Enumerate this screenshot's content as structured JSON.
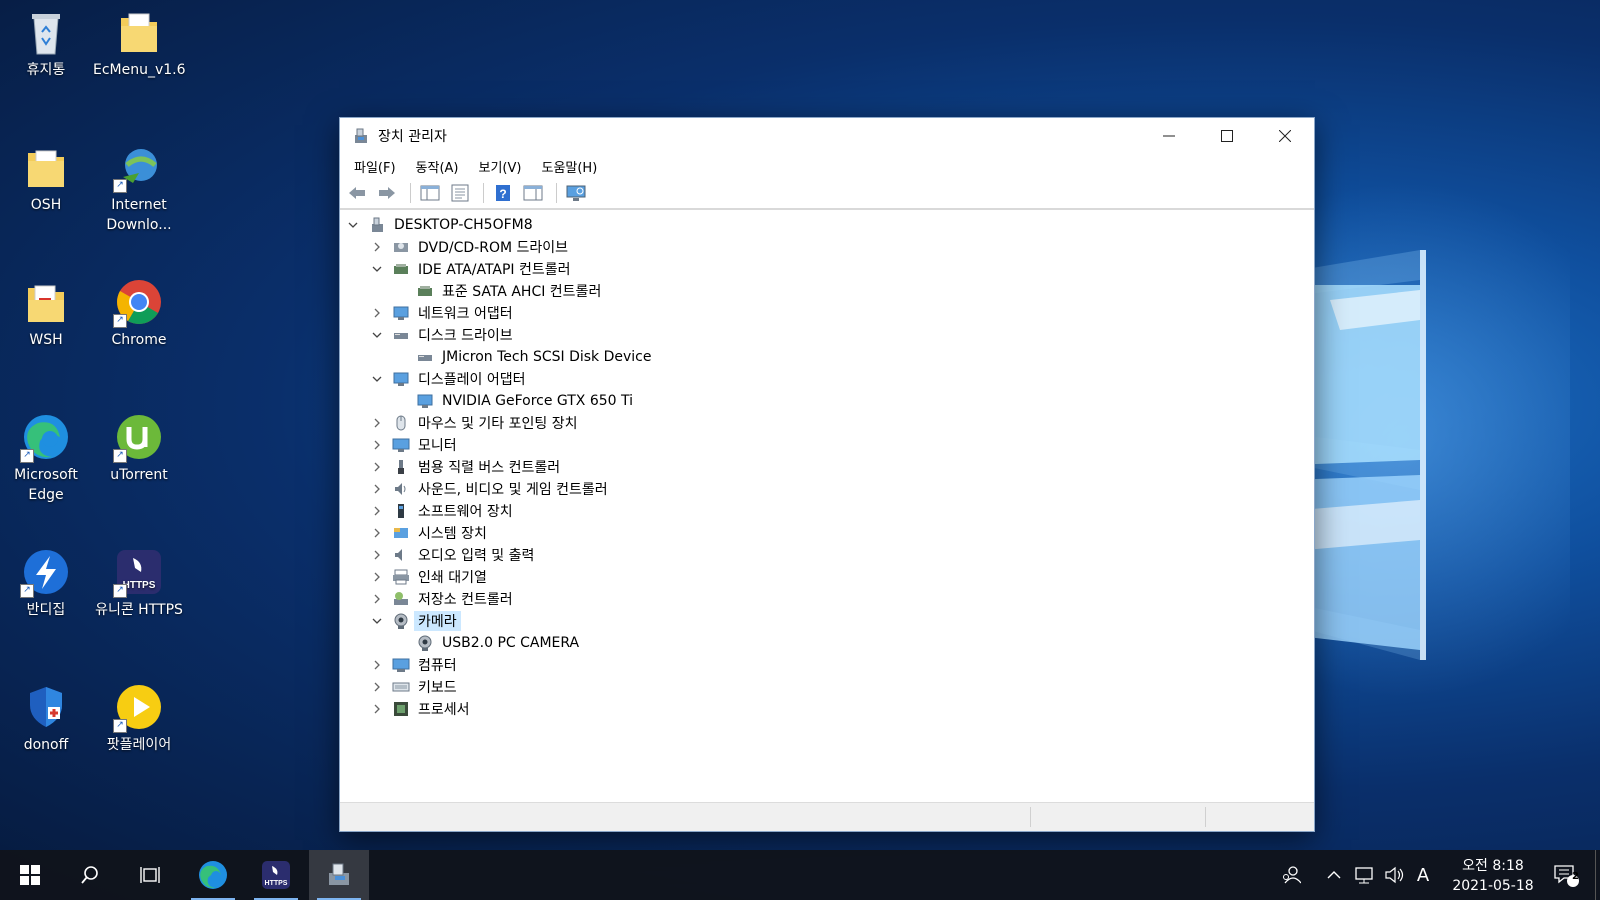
{
  "desktop": {
    "icons": [
      {
        "label": "휴지통"
      },
      {
        "label": "EcMenu_v1.6"
      },
      {
        "label": "OSH"
      },
      {
        "label": "Internet Downlo..."
      },
      {
        "label": "WSH"
      },
      {
        "label": "Chrome"
      },
      {
        "label": "Microsoft Edge"
      },
      {
        "label": "uTorrent"
      },
      {
        "label": "반디집"
      },
      {
        "label": "유니콘 HTTPS"
      },
      {
        "label": "donoff"
      },
      {
        "label": "팟플레이어"
      }
    ]
  },
  "window": {
    "title": "장치 관리자",
    "menu": [
      "파일(F)",
      "동작(A)",
      "보기(V)",
      "도움말(H)"
    ],
    "tree": {
      "root": "DESKTOP-CH5OFM8",
      "items": [
        {
          "label": "DVD/CD-ROM 드라이브",
          "expanded": false,
          "icon": "dvd-drive-icon"
        },
        {
          "label": "IDE ATA/ATAPI 컨트롤러",
          "expanded": true,
          "icon": "ide-controller-icon",
          "children": [
            "표준 SATA AHCI 컨트롤러"
          ]
        },
        {
          "label": "네트워크 어댑터",
          "expanded": false,
          "icon": "network-adapter-icon"
        },
        {
          "label": "디스크 드라이브",
          "expanded": true,
          "icon": "disk-drive-icon",
          "children": [
            "JMicron Tech SCSI Disk Device"
          ]
        },
        {
          "label": "디스플레이 어댑터",
          "expanded": true,
          "icon": "display-adapter-icon",
          "children": [
            "NVIDIA GeForce GTX 650 Ti"
          ]
        },
        {
          "label": "마우스 및 기타 포인팅 장치",
          "expanded": false,
          "icon": "mouse-icon"
        },
        {
          "label": "모니터",
          "expanded": false,
          "icon": "monitor-icon"
        },
        {
          "label": "범용 직렬 버스 컨트롤러",
          "expanded": false,
          "icon": "usb-controller-icon"
        },
        {
          "label": "사운드, 비디오 및 게임 컨트롤러",
          "expanded": false,
          "icon": "sound-icon"
        },
        {
          "label": "소프트웨어 장치",
          "expanded": false,
          "icon": "software-device-icon"
        },
        {
          "label": "시스템 장치",
          "expanded": false,
          "icon": "system-device-icon"
        },
        {
          "label": "오디오 입력 및 출력",
          "expanded": false,
          "icon": "audio-io-icon"
        },
        {
          "label": "인쇄 대기열",
          "expanded": false,
          "icon": "print-queue-icon"
        },
        {
          "label": "저장소 컨트롤러",
          "expanded": false,
          "icon": "storage-controller-icon"
        },
        {
          "label": "카메라",
          "expanded": true,
          "selected": true,
          "icon": "camera-icon",
          "children": [
            "USB2.0 PC CAMERA"
          ]
        },
        {
          "label": "컴퓨터",
          "expanded": false,
          "icon": "computer-icon"
        },
        {
          "label": "키보드",
          "expanded": false,
          "icon": "keyboard-icon"
        },
        {
          "label": "프로세서",
          "expanded": false,
          "icon": "processor-icon"
        }
      ]
    }
  },
  "taskbar": {
    "clock": {
      "time": "오전 8:18",
      "date": "2021-05-18"
    },
    "ime": "A",
    "notification_count": "2"
  },
  "colors": {
    "accent": "#0078d7",
    "selection": "#cce8ff",
    "taskbar": "#10141c"
  }
}
